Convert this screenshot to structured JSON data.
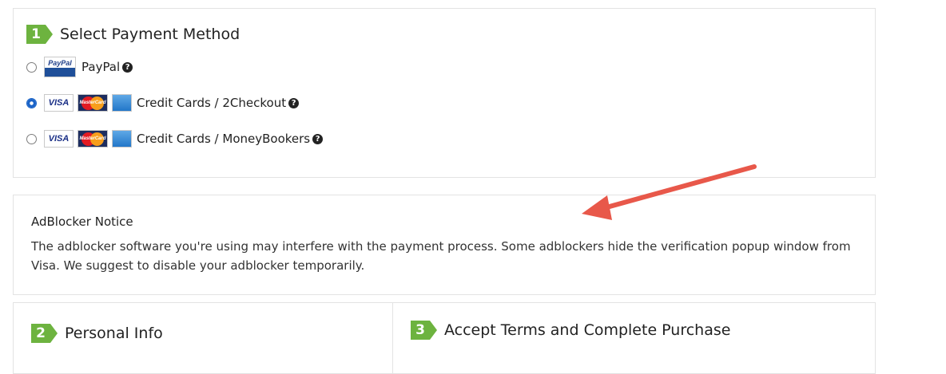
{
  "payment": {
    "step_number": "1",
    "title": "Select Payment Method",
    "methods": [
      {
        "label": "PayPal",
        "selected": false,
        "cards": [
          "paypal"
        ]
      },
      {
        "label": "Credit Cards / 2Checkout",
        "selected": true,
        "cards": [
          "visa",
          "mastercard",
          "amex"
        ]
      },
      {
        "label": "Credit Cards / MoneyBookers",
        "selected": false,
        "cards": [
          "visa",
          "mastercard",
          "amex"
        ]
      }
    ],
    "paypal_logo_text": "PayPal",
    "visa_text": "VISA",
    "mastercard_text": "MasterCard",
    "help_glyph": "?"
  },
  "notice": {
    "title": "AdBlocker Notice",
    "text": "The adblocker software you're using may interfere with the payment process. Some adblockers hide the verification popup window from Visa. We suggest to disable your adblocker temporarily."
  },
  "personal": {
    "step_number": "2",
    "title": "Personal Info"
  },
  "terms": {
    "step_number": "3",
    "title": "Accept Terms and Complete Purchase"
  },
  "colors": {
    "step_badge": "#6db33f",
    "annotation_arrow": "#e8584a",
    "radio_selected": "#1a63c7"
  }
}
